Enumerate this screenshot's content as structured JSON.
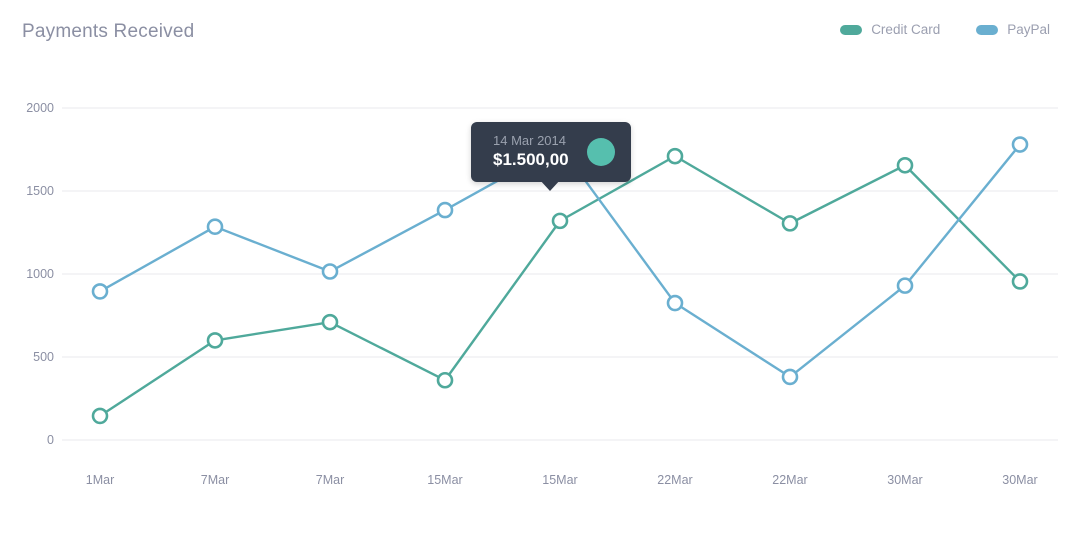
{
  "header": {
    "title": "Payments Received"
  },
  "legend": [
    {
      "label": "Credit Card",
      "color": "#4fa99b",
      "icon": "legend-swatch-icon"
    },
    {
      "label": "PayPal",
      "color": "#6aafd0",
      "icon": "legend-swatch-icon"
    }
  ],
  "tooltip": {
    "date": "14 Mar 2014",
    "value": "$1.500,00",
    "dot_color": "#56bfae"
  },
  "colors": {
    "credit_card": "#4fa99b",
    "paypal": "#6aafd0",
    "gridline": "#f0f0f3",
    "axis_text": "#8b8fa3",
    "title_text": "#8b8fa3",
    "tooltip_bg": "#343d4c",
    "background": "#ffffff"
  },
  "chart_data": {
    "type": "line",
    "title": "Payments Received",
    "xlabel": "",
    "ylabel": "",
    "categories": [
      "1Mar",
      "7Mar",
      "7Mar",
      "15Mar",
      "15Mar",
      "22Mar",
      "22Mar",
      "30Mar",
      "30Mar"
    ],
    "series": [
      {
        "name": "Credit Card",
        "color": "#4fa99b",
        "values": [
          145,
          600,
          710,
          360,
          1320,
          1710,
          1305,
          1655,
          955
        ]
      },
      {
        "name": "PayPal",
        "color": "#6aafd0",
        "values": [
          895,
          1285,
          1015,
          1385,
          1770,
          825,
          380,
          930,
          1780
        ]
      }
    ],
    "yticks": [
      0,
      500,
      1000,
      1500,
      2000
    ],
    "ylim": [
      0,
      2000
    ],
    "grid": true,
    "legend_position": "top-right",
    "markers": "hollow-circle",
    "annotations": [
      {
        "type": "tooltip",
        "date": "14 Mar 2014",
        "value": "$1.500,00",
        "series": "Credit Card",
        "x_index": 4
      }
    ]
  }
}
